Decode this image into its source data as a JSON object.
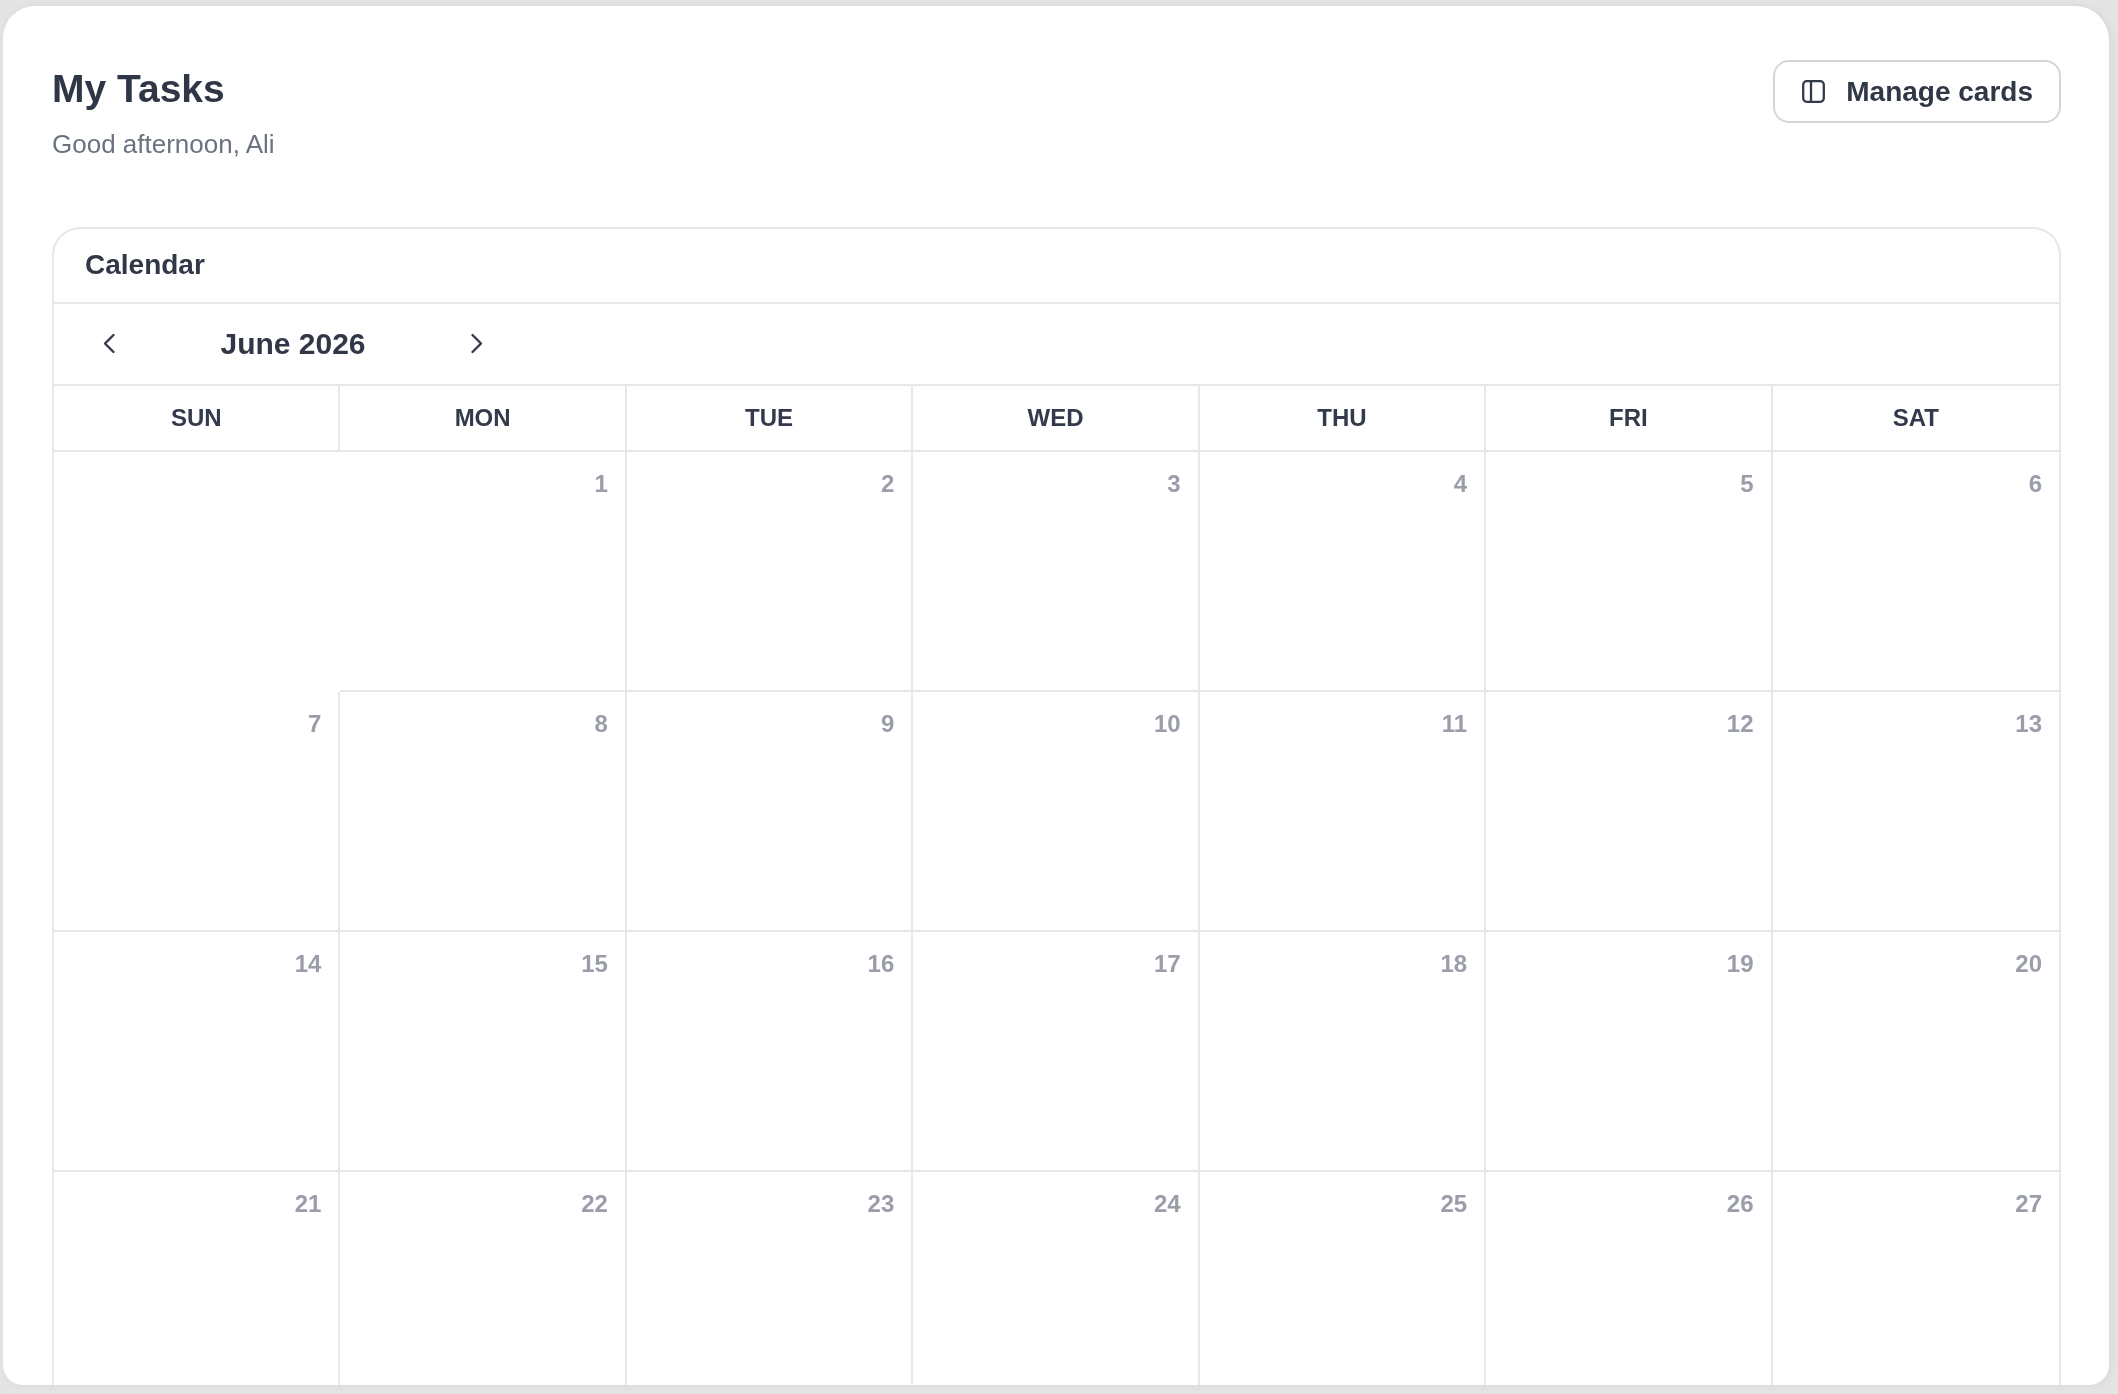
{
  "header": {
    "title": "My Tasks",
    "greeting": "Good afternoon, Ali"
  },
  "manage_cards_button": {
    "label": "Manage cards"
  },
  "calendar": {
    "title": "Calendar",
    "month": "June 2026",
    "weekdays": [
      "SUN",
      "MON",
      "TUE",
      "WED",
      "THU",
      "FRI",
      "SAT"
    ],
    "days": [
      {
        "kind": "blank"
      },
      {
        "kind": "day",
        "label": "1"
      },
      {
        "kind": "day",
        "label": "2"
      },
      {
        "kind": "day",
        "label": "3"
      },
      {
        "kind": "day",
        "label": "4"
      },
      {
        "kind": "day",
        "label": "5"
      },
      {
        "kind": "day",
        "label": "6"
      },
      {
        "kind": "day",
        "label": "7"
      },
      {
        "kind": "day",
        "label": "8"
      },
      {
        "kind": "day",
        "label": "9"
      },
      {
        "kind": "day",
        "label": "10"
      },
      {
        "kind": "day",
        "label": "11"
      },
      {
        "kind": "day",
        "label": "12"
      },
      {
        "kind": "day",
        "label": "13"
      },
      {
        "kind": "day",
        "label": "14"
      },
      {
        "kind": "day",
        "label": "15"
      },
      {
        "kind": "day",
        "label": "16"
      },
      {
        "kind": "day",
        "label": "17"
      },
      {
        "kind": "day",
        "label": "18"
      },
      {
        "kind": "day",
        "label": "19"
      },
      {
        "kind": "day",
        "label": "20"
      },
      {
        "kind": "day",
        "label": "21"
      },
      {
        "kind": "day",
        "label": "22"
      },
      {
        "kind": "day",
        "label": "23"
      },
      {
        "kind": "day",
        "label": "24"
      },
      {
        "kind": "day",
        "label": "25"
      },
      {
        "kind": "day",
        "label": "26"
      },
      {
        "kind": "day",
        "label": "27"
      }
    ]
  }
}
